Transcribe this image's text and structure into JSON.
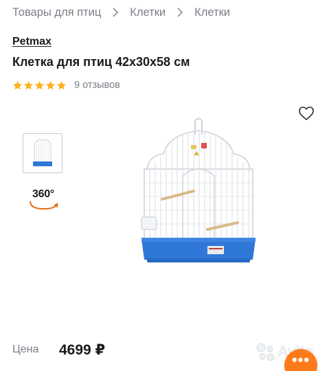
{
  "breadcrumb": {
    "items": [
      "Товары для птиц",
      "Клетки",
      "Клетки"
    ]
  },
  "product": {
    "brand": "Petmax",
    "title": "Клетка для птиц 42x30x58 см",
    "rating": 5,
    "reviews_label": "9 отзывов",
    "view360_label": "360°",
    "price_label": "Цена",
    "price_value": "4699 ₽"
  },
  "watermark": {
    "text": "Avito"
  },
  "colors": {
    "star": "#ffb21e",
    "accent": "#ff7a1a",
    "cage_base": "#2f78d8",
    "text_secondary": "#7a7f86"
  },
  "icons": {
    "favorite": "heart-outline-icon",
    "separator": "chevron-right-icon",
    "rotate": "rotate-360-icon",
    "more": "more-dots-icon"
  }
}
